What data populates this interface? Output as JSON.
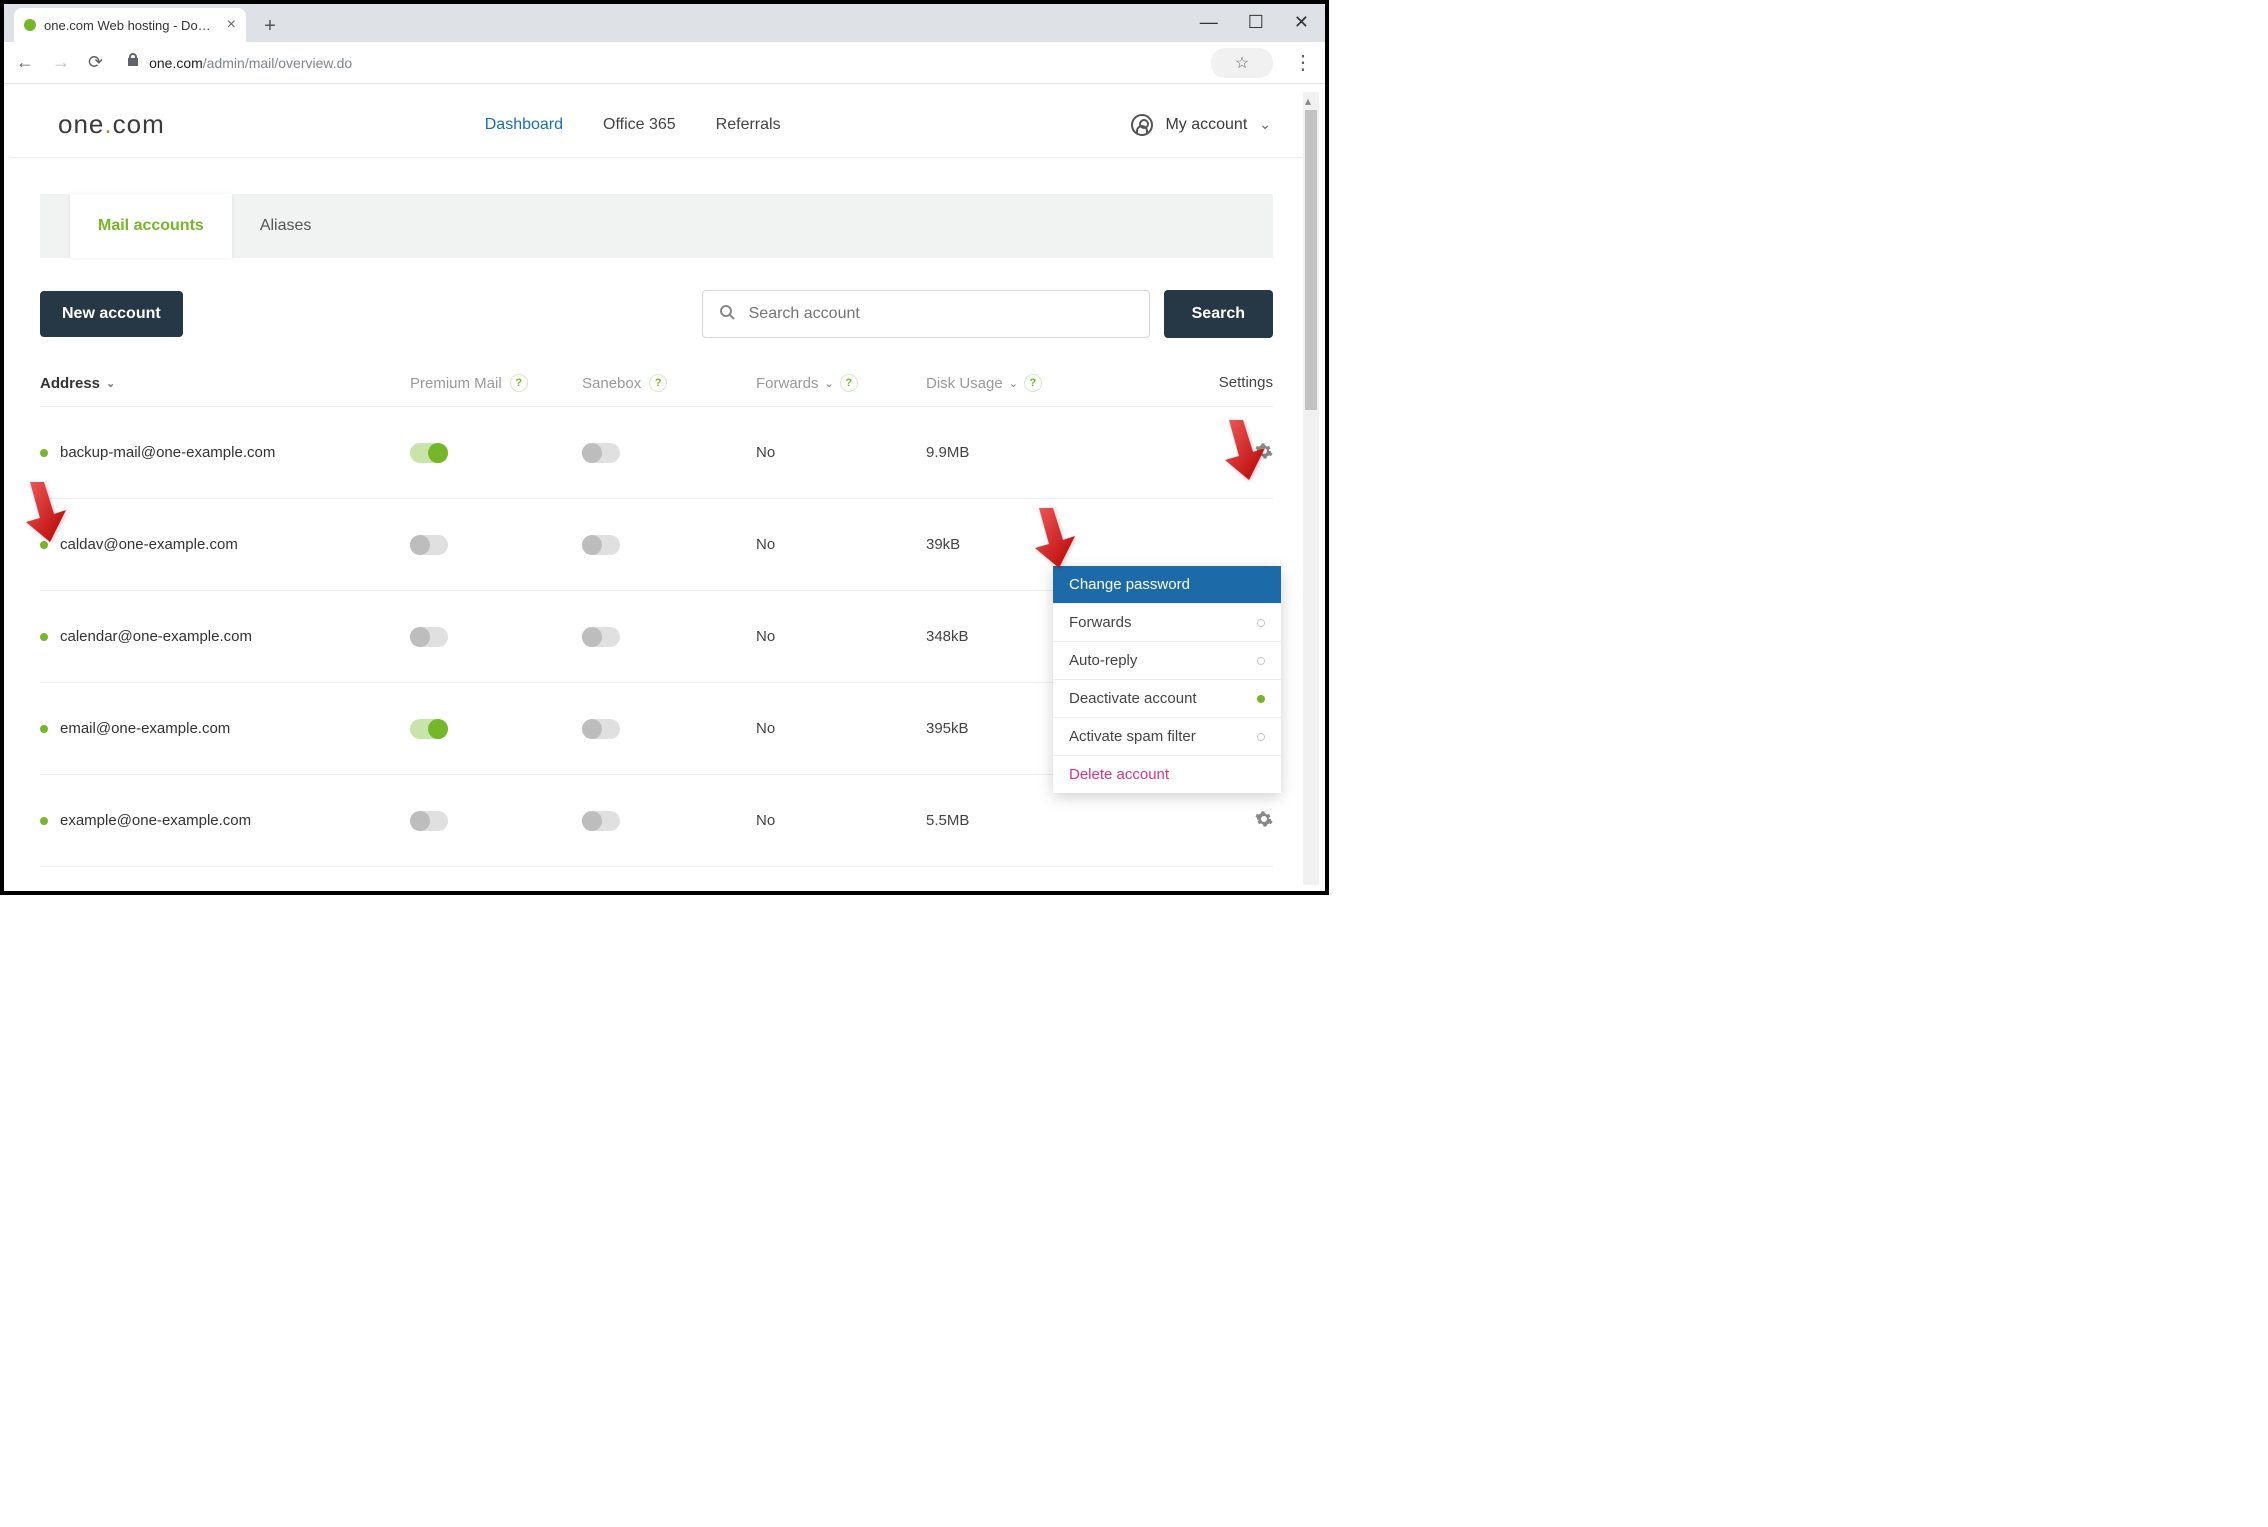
{
  "window": {
    "tab_title": "one.com Web hosting - Domain...",
    "url_domain": "one.com",
    "url_path": "/admin/mail/overview.do"
  },
  "header": {
    "logo_pre": "one",
    "logo_post": "com",
    "nav": {
      "dashboard": "Dashboard",
      "office365": "Office 365",
      "referrals": "Referrals"
    },
    "account_label": "My account"
  },
  "subtabs": {
    "mail_accounts": "Mail accounts",
    "aliases": "Aliases"
  },
  "actions": {
    "new_account": "New account",
    "search_placeholder": "Search account",
    "search_button": "Search"
  },
  "columns": {
    "address": "Address",
    "premium": "Premium Mail",
    "sanebox": "Sanebox",
    "forwards": "Forwards",
    "disk": "Disk Usage",
    "settings": "Settings"
  },
  "rows": [
    {
      "email": "backup-mail@one-example.com",
      "premium_on": true,
      "sanebox_on": false,
      "forwards": "No",
      "disk": "9.9MB"
    },
    {
      "email": "caldav@one-example.com",
      "premium_on": false,
      "sanebox_on": false,
      "forwards": "No",
      "disk": "39kB"
    },
    {
      "email": "calendar@one-example.com",
      "premium_on": false,
      "sanebox_on": false,
      "forwards": "No",
      "disk": "348kB"
    },
    {
      "email": "email@one-example.com",
      "premium_on": true,
      "sanebox_on": false,
      "forwards": "No",
      "disk": "395kB"
    },
    {
      "email": "example@one-example.com",
      "premium_on": false,
      "sanebox_on": false,
      "forwards": "No",
      "disk": "5.5MB"
    }
  ],
  "dropdown": {
    "change_password": "Change password",
    "forwards": "Forwards",
    "auto_reply": "Auto-reply",
    "deactivate": "Deactivate account",
    "spam_filter": "Activate spam filter",
    "delete": "Delete account"
  }
}
